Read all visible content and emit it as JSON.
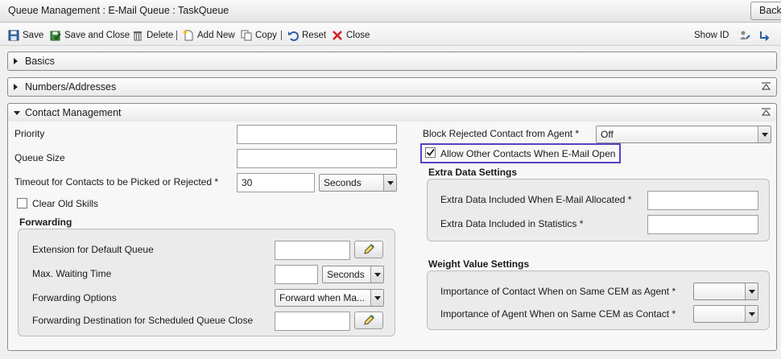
{
  "window": {
    "title": "Queue Management : E-Mail Queue : TaskQueue",
    "back_label": "Back"
  },
  "toolbar": {
    "save": "Save",
    "save_close": "Save and Close",
    "delete": "Delete",
    "add_new": "Add New",
    "copy": "Copy",
    "reset": "Reset",
    "close": "Close",
    "show_id": "Show ID"
  },
  "panels": {
    "basics": "Basics",
    "numbers": "Numbers/Addresses",
    "contact": "Contact Management"
  },
  "left": {
    "priority_label": "Priority",
    "priority_value": "",
    "queue_size_label": "Queue Size",
    "queue_size_value": "",
    "timeout_label": "Timeout for Contacts to be Picked or Rejected *",
    "timeout_value": "30",
    "timeout_unit": "Seconds",
    "clear_old_skills": "Clear Old Skills",
    "clear_old_skills_checked": false
  },
  "forwarding": {
    "title": "Forwarding",
    "ext_default_label": "Extension for Default Queue",
    "ext_default_value": "",
    "max_wait_label": "Max. Waiting Time",
    "max_wait_value": "",
    "max_wait_unit": "Seconds",
    "options_label": "Forwarding Options",
    "options_value": "Forward when Ma...",
    "dest_label": "Forwarding Destination for Scheduled Queue Close",
    "dest_value": ""
  },
  "right": {
    "block_label": "Block Rejected Contact from Agent *",
    "block_value": "Off",
    "allow_label": "Allow Other Contacts When E-Mail Open",
    "allow_checked": true
  },
  "extra_data": {
    "title": "Extra Data Settings",
    "allocated_label": "Extra Data Included When E-Mail Allocated *",
    "allocated_value": "",
    "statistics_label": "Extra Data Included in Statistics *",
    "statistics_value": ""
  },
  "weight": {
    "title": "Weight Value Settings",
    "contact_label": "Importance of Contact When on Same CEM as Agent *",
    "contact_value": "",
    "agent_label": "Importance of Agent When on Same CEM as Contact *",
    "agent_value": ""
  },
  "colors": {
    "focus_outline": "#5b3fc4",
    "delete_red": "#d42020",
    "save_green": "#2e8b2e"
  }
}
